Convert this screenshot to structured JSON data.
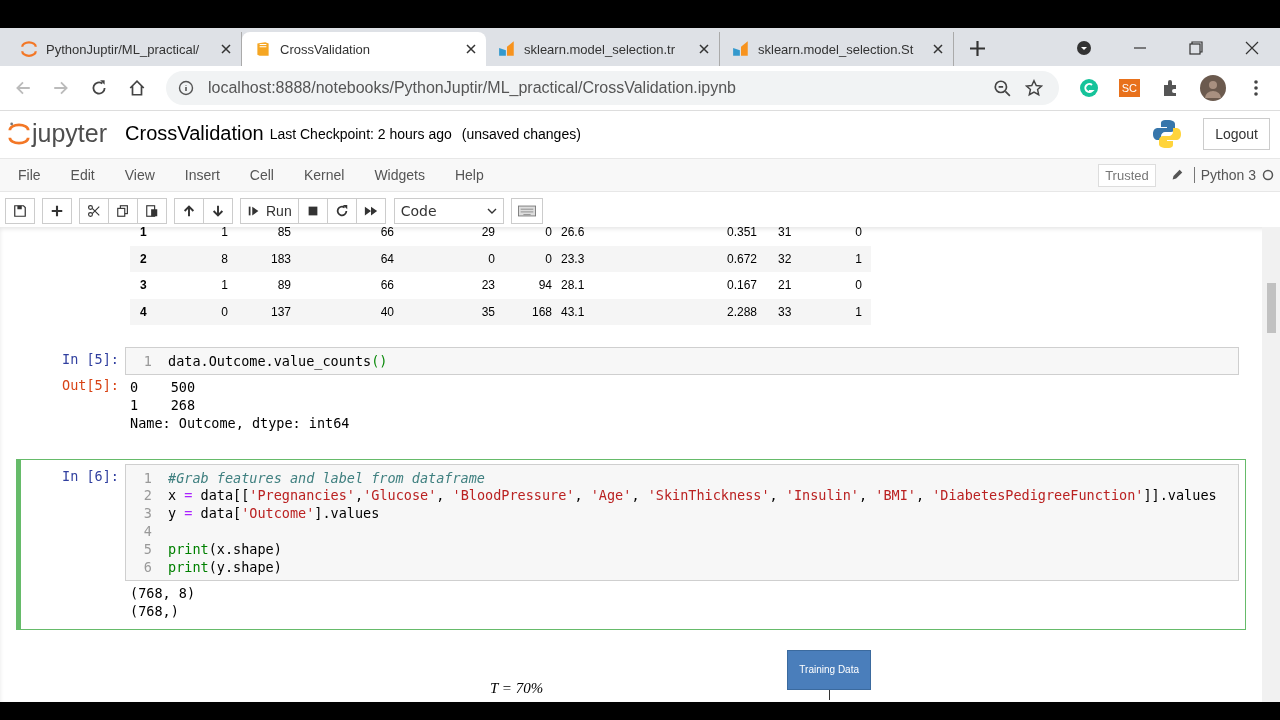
{
  "browser": {
    "tabs": [
      {
        "title": "PythonJuptir/ML_practical/",
        "selected": false
      },
      {
        "title": "CrossValidation",
        "selected": true
      },
      {
        "title": "sklearn.model_selection.tr",
        "selected": false
      },
      {
        "title": "sklearn.model_selection.St",
        "selected": false
      }
    ],
    "url": "localhost:8888/notebooks/PythonJuptir/ML_practical/CrossValidation.ipynb",
    "extension_label": "SC"
  },
  "header": {
    "logo": "jupyter",
    "notebook_name": "CrossValidation",
    "checkpoint": "Last Checkpoint: 2 hours ago",
    "status": "(unsaved changes)",
    "logout": "Logout"
  },
  "menu": [
    "File",
    "Edit",
    "View",
    "Insert",
    "Cell",
    "Kernel",
    "Widgets",
    "Help"
  ],
  "kernel": {
    "trusted": "Trusted",
    "name": "Python 3",
    "busy": false
  },
  "toolbar": {
    "run": "Run",
    "cell_type": "Code"
  },
  "table": {
    "rows": [
      {
        "index": "1",
        "values": [
          "1",
          "85",
          "66",
          "29",
          "0",
          "26.6",
          "0.351",
          "31",
          "0"
        ]
      },
      {
        "index": "2",
        "values": [
          "8",
          "183",
          "64",
          "0",
          "0",
          "23.3",
          "0.672",
          "32",
          "1"
        ]
      },
      {
        "index": "3",
        "values": [
          "1",
          "89",
          "66",
          "23",
          "94",
          "28.1",
          "0.167",
          "21",
          "0"
        ]
      },
      {
        "index": "4",
        "values": [
          "0",
          "137",
          "40",
          "35",
          "168",
          "43.1",
          "2.288",
          "33",
          "1"
        ]
      }
    ]
  },
  "cells": [
    {
      "prompt": "In [5]:",
      "selected": false,
      "lines": [
        {
          "number": "1",
          "tokens": [
            {
              "text": "data.Outcome.value_counts",
              "kind": "plain"
            },
            {
              "text": "()",
              "kind": "paren"
            }
          ]
        }
      ],
      "out_prompt": "Out[5]:",
      "output": [
        "0    500",
        "1    268",
        "Name: Outcome, dtype: int64"
      ]
    },
    {
      "prompt": "In [6]:",
      "selected": true,
      "lines": [
        {
          "number": "1",
          "tokens": [
            {
              "text": "#Grab features and label from dataframe",
              "kind": "comment"
            }
          ]
        },
        {
          "number": "2",
          "tokens": [
            {
              "text": "x",
              "kind": "plain"
            },
            {
              "text": " = ",
              "kind": "op"
            },
            {
              "text": "data[[",
              "kind": "plain"
            },
            {
              "text": "'Pregnancies'",
              "kind": "string"
            },
            {
              "text": ",",
              "kind": "plain"
            },
            {
              "text": "'Glucose'",
              "kind": "string"
            },
            {
              "text": ", ",
              "kind": "plain"
            },
            {
              "text": "'BloodPressure'",
              "kind": "string"
            },
            {
              "text": ", ",
              "kind": "plain"
            },
            {
              "text": "'Age'",
              "kind": "string"
            },
            {
              "text": ", ",
              "kind": "plain"
            },
            {
              "text": "'SkinThickness'",
              "kind": "string"
            },
            {
              "text": ", ",
              "kind": "plain"
            },
            {
              "text": "'Insulin'",
              "kind": "string"
            },
            {
              "text": ", ",
              "kind": "plain"
            },
            {
              "text": "'BMI'",
              "kind": "string"
            },
            {
              "text": ", ",
              "kind": "plain"
            },
            {
              "text": "'DiabetesPedigreeFunction'",
              "kind": "string"
            },
            {
              "text": "]].values",
              "kind": "plain"
            }
          ]
        },
        {
          "number": "3",
          "tokens": [
            {
              "text": "y",
              "kind": "plain"
            },
            {
              "text": " = ",
              "kind": "op"
            },
            {
              "text": "data[",
              "kind": "plain"
            },
            {
              "text": "'Outcome'",
              "kind": "string"
            },
            {
              "text": "].values",
              "kind": "plain"
            }
          ]
        },
        {
          "number": "4"
        },
        {
          "number": "5",
          "tokens": [
            {
              "text": "print",
              "kind": "builtin"
            },
            {
              "text": "(x.shape)",
              "kind": "plain"
            }
          ]
        },
        {
          "number": "6",
          "tokens": [
            {
              "text": "print",
              "kind": "builtin"
            },
            {
              "text": "(y.shape)",
              "kind": "plain"
            }
          ]
        }
      ],
      "output": [
        "(768, 8)",
        "(768,)"
      ]
    }
  ],
  "figure": {
    "formula": "T = 70%",
    "box_label": "Training Data"
  }
}
